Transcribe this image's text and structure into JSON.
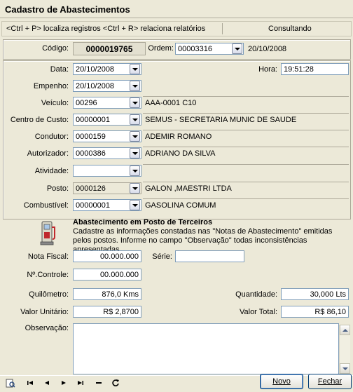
{
  "window": {
    "title": "Cadastro de Abastecimentos"
  },
  "shortcut_bar": {
    "hints": "<Ctrl + P> localiza registros  <Ctrl + R> relaciona relatórios",
    "status": "Consultando"
  },
  "header": {
    "codigo_label": "Código:",
    "codigo_value": "0000019765",
    "ordem_label": "Ordem:",
    "ordem_value": "00003316",
    "ordem_date": "20/10/2008"
  },
  "form": {
    "data_label": "Data:",
    "data_value": "20/10/2008",
    "hora_label": "Hora:",
    "hora_value": "19:51:28",
    "empenho_label": "Empenho:",
    "empenho_value": "20/10/2008",
    "veiculo_label": "Veículo:",
    "veiculo_value": "00296",
    "veiculo_desc": "AAA-0001  C10",
    "centro_label": "Centro de Custo:",
    "centro_value": "00000001",
    "centro_desc": "SEMUS - SECRETARIA MUNIC DE SAUDE",
    "condutor_label": "Condutor:",
    "condutor_value": "0000159",
    "condutor_desc": "ADEMIR ROMANO",
    "autorizador_label": "Autorizador:",
    "autorizador_value": "0000386",
    "autorizador_desc": "ADRIANO DA SILVA",
    "atividade_label": "Atividade:",
    "atividade_value": "",
    "atividade_desc": "",
    "posto_label": "Posto:",
    "posto_value": "0000126",
    "posto_desc": "GALON ,MAESTRI LTDA",
    "combustivel_label": "Combustível:",
    "combustivel_value": "00000001",
    "combustivel_desc": "GASOLINA COMUM"
  },
  "terceiros": {
    "title": "Abastecimento em Posto de Terceiros",
    "description": "Cadastre as informações constadas nas  \"Notas de Abastecimento\" emitidas pelos postos. Informe no campo \"Observação\" todas inconsistências apresentadas.",
    "nota_label": "Nota Fiscal:",
    "nota_value": "00.000.000",
    "serie_label": "Série:",
    "serie_value": "",
    "controle_label": "Nº.Controle:",
    "controle_value": "00.000.000",
    "km_label": "Quilômetro:",
    "km_value": "876,0 Kms",
    "qtd_label": "Quantidade:",
    "qtd_value": "30,000 Lts",
    "unit_label": "Valor Unitário:",
    "unit_value": "R$ 2,8700",
    "total_label": "Valor Total:",
    "total_value": "R$ 86,10",
    "obs_label": "Observação:",
    "obs_value": ""
  },
  "footer": {
    "novo_label": "Novo",
    "fechar_label": "Fechar",
    "nav_icons": [
      "search-icon",
      "first-record-icon",
      "prior-record-icon",
      "next-record-icon",
      "last-record-icon",
      "delete-record-icon",
      "refresh-icon"
    ]
  }
}
